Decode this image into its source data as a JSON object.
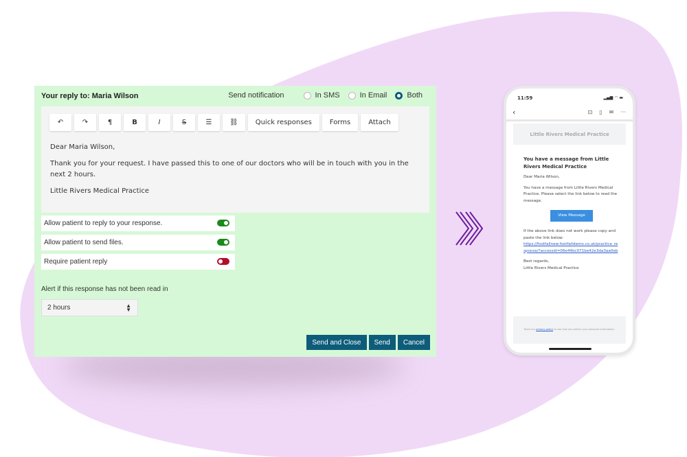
{
  "colors": {
    "panel": "#d6f8d6",
    "accent": "#0d5c7a",
    "toggle_on": "#1a8a1a",
    "toggle_off": "#b3102a",
    "blob": "#f0d9f6",
    "chevron": "#6b1fa0"
  },
  "reply": {
    "title": "Your reply to: Maria Wilson",
    "notification": {
      "label": "Send notification",
      "options": [
        {
          "label": "In SMS",
          "selected": false
        },
        {
          "label": "In Email",
          "selected": false
        },
        {
          "label": "Both",
          "selected": true
        }
      ]
    },
    "toolbar": [
      {
        "icon": "undo-icon",
        "glyph": "↶"
      },
      {
        "icon": "redo-icon",
        "glyph": "↷"
      },
      {
        "icon": "paragraph-icon",
        "glyph": "¶"
      },
      {
        "icon": "bold-icon",
        "glyph": "B"
      },
      {
        "icon": "italic-icon",
        "glyph": "I"
      },
      {
        "icon": "strikethrough-icon",
        "glyph": "S"
      },
      {
        "icon": "list-icon",
        "glyph": "☰"
      },
      {
        "icon": "link-icon",
        "glyph": "⛓"
      }
    ],
    "toolbar_buttons": [
      "Quick responses",
      "Forms",
      "Attach"
    ],
    "body": [
      "Dear Maria Wilson,",
      "Thank you for your request. I have passed this to one of our doctors who will be in touch with you in the next 2 hours.",
      "Little Rivers Medical Practice"
    ],
    "toggles": [
      {
        "label": "Allow patient to reply to your response.",
        "on": true
      },
      {
        "label": "Allow patient to send files.",
        "on": true
      },
      {
        "label": "Require patient reply",
        "on": false
      }
    ],
    "alert_label": "Alert if this response has not been read in",
    "alert_value": "2 hours",
    "actions": [
      "Send and Close",
      "Send",
      "Cancel"
    ]
  },
  "phone": {
    "time": "11:59",
    "banner": "Little Rivers Medical Practice",
    "heading": "You have a message from Little Rivers Medical Practice",
    "greeting": "Dear Maria Wilson,",
    "intro": "You have a message from Little Rivers Medical Practice. Please select the link below to read the message.",
    "button": "View Message",
    "fallback": "If the above link does not work please copy and paste the link below:",
    "link": "https://footfallnew.footfalldemo.co.uk/practice_response/?accessid=06e44bc071be42e3da3aa0eb",
    "signoff": "Best regards,",
    "signature": "Little Rivers Medical Practice",
    "footer_pre": "Read our",
    "footer_link": "privacy policy",
    "footer_post": "to see how we protect your personal information."
  }
}
